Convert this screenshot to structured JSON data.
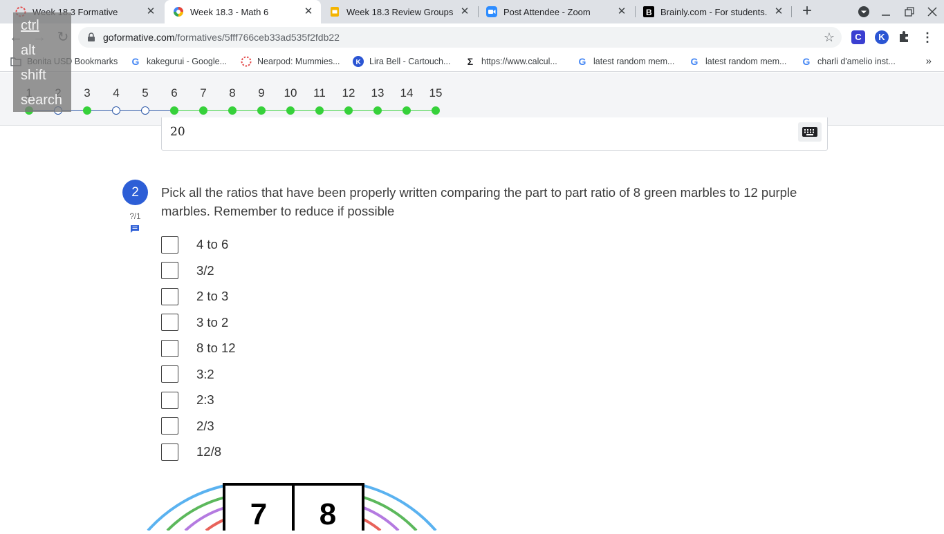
{
  "browser": {
    "tabs": [
      {
        "title": "Week 18.3 Formative",
        "icon": "formative-icon",
        "active": false
      },
      {
        "title": "Week 18.3 - Math 6",
        "icon": "google-classroom-icon",
        "active": true
      },
      {
        "title": "Week 18.3 Review Groups - G",
        "icon": "google-slides-icon",
        "active": false
      },
      {
        "title": "Post Attendee - Zoom",
        "icon": "zoom-icon",
        "active": false
      },
      {
        "title": "Brainly.com - For students. B",
        "icon": "brainly-icon",
        "active": false
      }
    ],
    "url_host": "goformative.com",
    "url_path": "/formatives/5fff766ceb33ad535f2fdb22",
    "extensions": [
      "C",
      "K"
    ],
    "bookmarks": [
      {
        "label": "Bonita USD Bookmarks",
        "icon": "folder-icon"
      },
      {
        "label": "kakegurui - Google...",
        "icon": "google-icon"
      },
      {
        "label": "Nearpod: Mummies...",
        "icon": "nearpod-icon"
      },
      {
        "label": "Lira Bell - Cartouch...",
        "icon": "khan-icon"
      },
      {
        "label": "https://www.calcul...",
        "icon": "sigma-icon"
      },
      {
        "label": "latest random mem...",
        "icon": "google-icon"
      },
      {
        "label": "latest random mem...",
        "icon": "google-icon"
      },
      {
        "label": "charli d'amelio inst...",
        "icon": "google-icon"
      }
    ],
    "bookmarks_more": "»"
  },
  "keyboard_overlay": [
    "ctrl",
    "alt",
    "shift",
    "search"
  ],
  "question_nav": {
    "items": [
      {
        "n": "1",
        "state": "done"
      },
      {
        "n": "2",
        "state": "open"
      },
      {
        "n": "3",
        "state": "done"
      },
      {
        "n": "4",
        "state": "open"
      },
      {
        "n": "5",
        "state": "open"
      },
      {
        "n": "6",
        "state": "done"
      },
      {
        "n": "7",
        "state": "done"
      },
      {
        "n": "8",
        "state": "done"
      },
      {
        "n": "9",
        "state": "done"
      },
      {
        "n": "10",
        "state": "done"
      },
      {
        "n": "11",
        "state": "done"
      },
      {
        "n": "12",
        "state": "done"
      },
      {
        "n": "13",
        "state": "done"
      },
      {
        "n": "14",
        "state": "done"
      },
      {
        "n": "15",
        "state": "done"
      }
    ],
    "colors": {
      "done": "#36d13a",
      "open_border": "#2b57a7"
    }
  },
  "previous_answer": {
    "value": "20"
  },
  "question": {
    "number": "2",
    "score": "?/1",
    "prompt": "Pick all the ratios that have been properly written comparing the part to part ratio of 8 green marbles to 12 purple marbles. Remember to reduce if possible",
    "choices": [
      "4 to 6",
      "3/2",
      "2 to 3",
      "3 to 2",
      "8 to 12",
      "3:2",
      "2:3",
      "2/3",
      "12/8"
    ]
  },
  "figure": {
    "left_number": "7",
    "right_number": "8"
  }
}
